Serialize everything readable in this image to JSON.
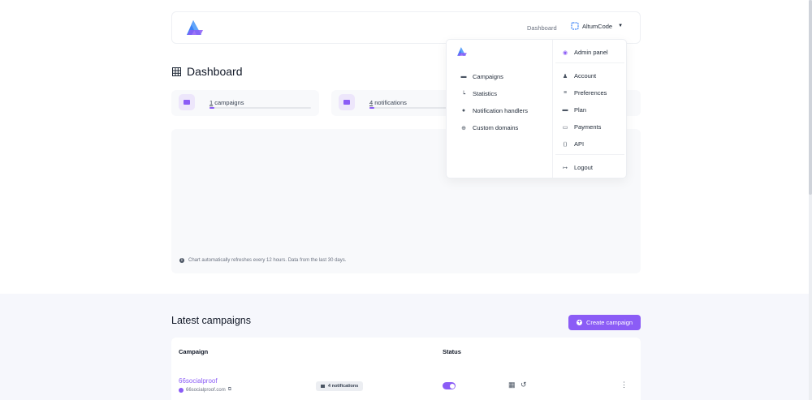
{
  "colors": {
    "accent": "#8b5cf6",
    "accent_soft": "#ede6fb",
    "page_bg": "#ffffff",
    "section_bg": "#f6f7fc"
  },
  "navbar": {
    "logo_icon": "altum-logo-icon",
    "dashboard_link": "Dashboard",
    "user_name": "AltumCode",
    "user_icon": "user-square-icon",
    "caret_icon": "caret-down-icon"
  },
  "page_title": "Dashboard",
  "stats": [
    {
      "count": "1",
      "label": " campaigns",
      "icon": "campaign-icon",
      "progress": 0.05
    },
    {
      "count": "4",
      "label": " notifications",
      "icon": "notification-icon",
      "progress": 0.05
    }
  ],
  "chart_note": "Chart automatically refreshes every 12 hours. Data from the last 30 days.",
  "dropdown": {
    "left": [
      {
        "label": "Campaigns",
        "icon": "campaign-icon"
      },
      {
        "label": "Statistics",
        "icon": "chart-icon"
      },
      {
        "label": "Notification handlers",
        "icon": "bell-icon"
      },
      {
        "label": "Custom domains",
        "icon": "globe-icon"
      }
    ],
    "admin": {
      "label": "Admin panel",
      "icon": "fingerprint-icon"
    },
    "right": [
      {
        "label": "Account",
        "icon": "user-icon"
      },
      {
        "label": "Preferences",
        "icon": "sliders-icon"
      },
      {
        "label": "Plan",
        "icon": "box-icon"
      },
      {
        "label": "Payments",
        "icon": "credit-card-icon"
      },
      {
        "label": "API",
        "icon": "code-icon"
      }
    ],
    "logout": {
      "label": "Logout",
      "icon": "logout-icon"
    }
  },
  "latest": {
    "title": "Latest campaigns",
    "create_button": "Create campaign",
    "headers": {
      "campaign": "Campaign",
      "status": "Status"
    },
    "rows": [
      {
        "name": "66socialproof",
        "domain": "66socialproof.com",
        "notifications": "4 notifications",
        "enabled": true
      }
    ]
  }
}
